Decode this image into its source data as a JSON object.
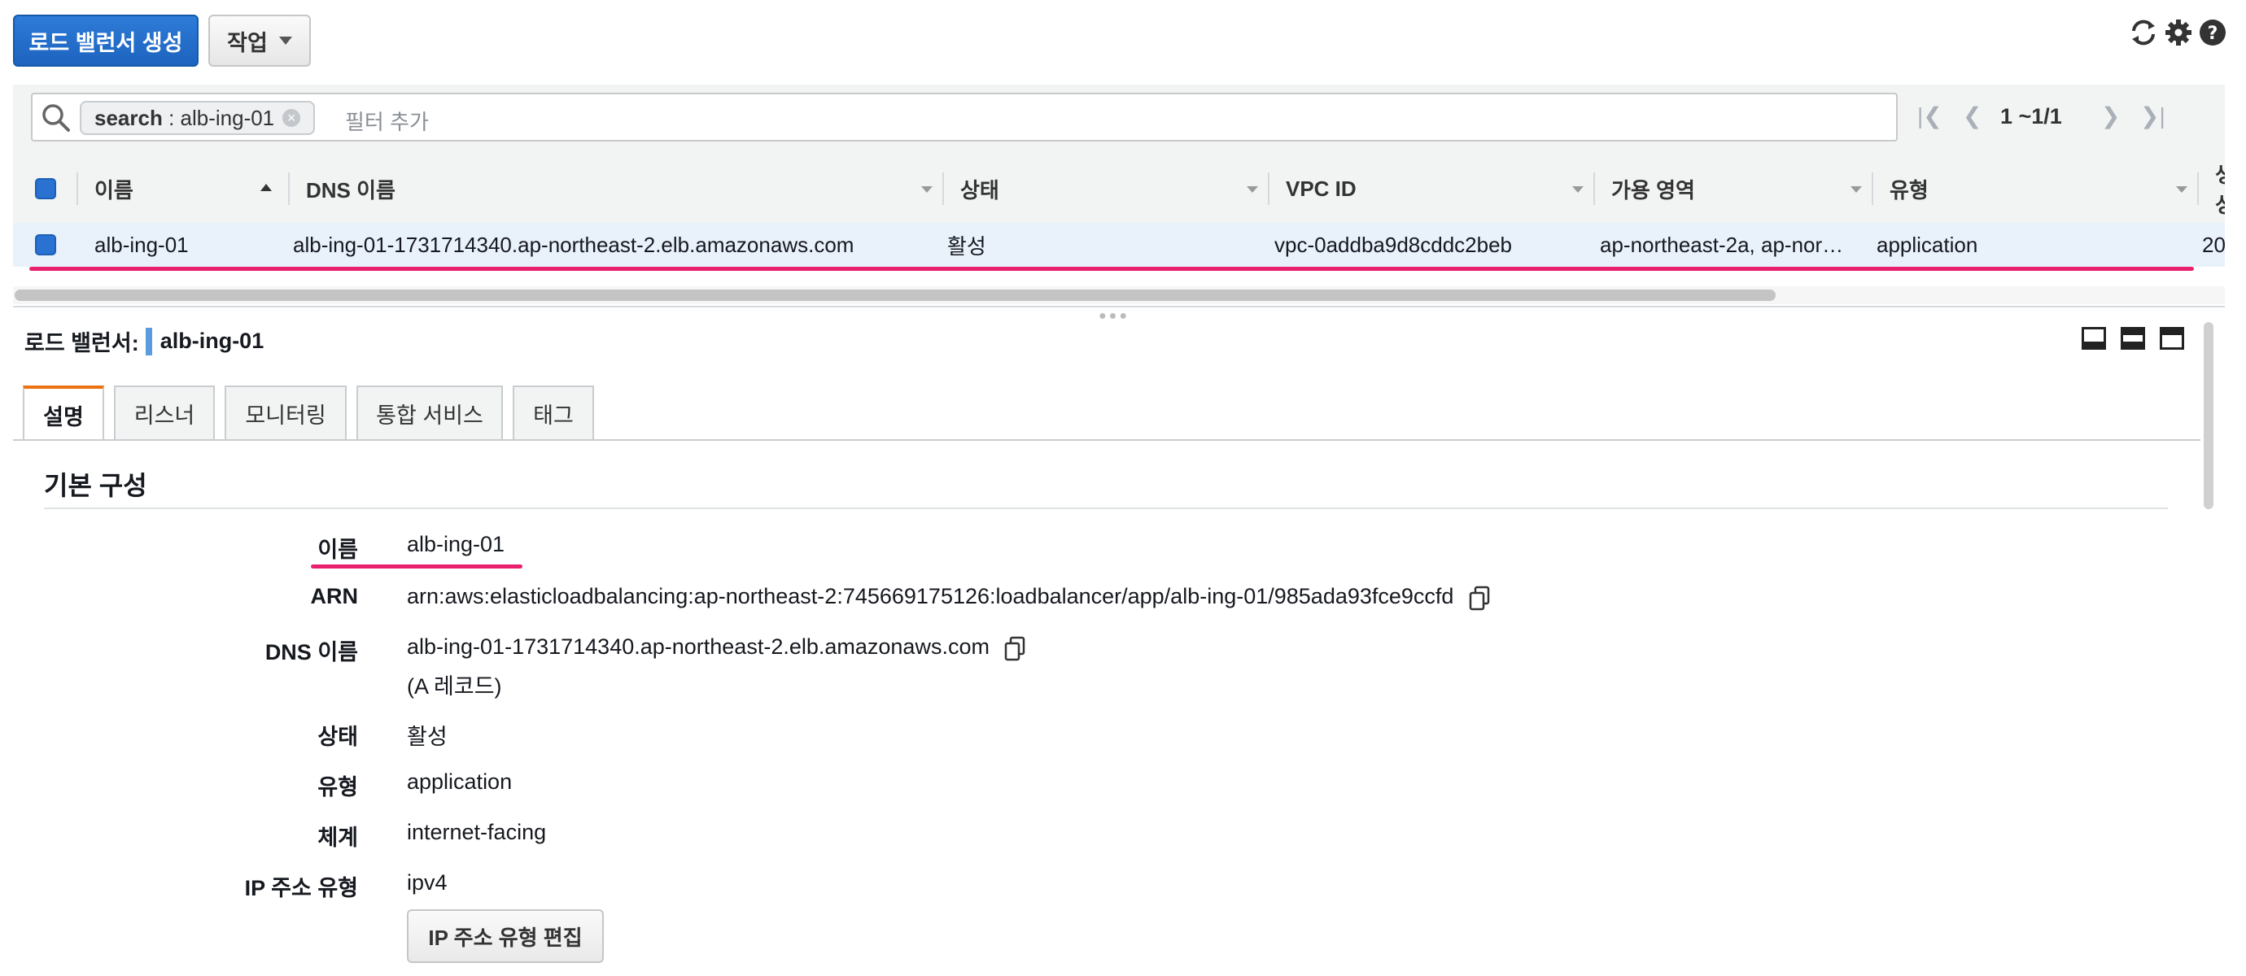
{
  "toolbar": {
    "create_label": "로드 밸런서 생성",
    "actions_label": "작업",
    "icons": [
      "refresh-icon",
      "gear-icon",
      "help-icon"
    ]
  },
  "filter": {
    "token_key": "search",
    "token_value": " : alb-ing-01",
    "placeholder": "필터 추가",
    "pagination": "1 ~1/1"
  },
  "table": {
    "columns": [
      "이름",
      "DNS 이름",
      "상태",
      "VPC ID",
      "가용 영역",
      "유형",
      "생성"
    ],
    "rows": [
      {
        "name": "alb-ing-01",
        "dns": "alb-ing-01-1731714340.ap-northeast-2.elb.amazonaws.com",
        "state": "활성",
        "vpc": "vpc-0addba9d8cddc2beb",
        "az": "ap-northeast-2a, ap-nor…",
        "type": "application",
        "created": "20"
      }
    ]
  },
  "details": {
    "title_prefix": "로드 밸런서:",
    "title_name": "alb-ing-01",
    "tabs": [
      "설명",
      "리스너",
      "모니터링",
      "통합 서비스",
      "태그"
    ],
    "active_tab": "설명",
    "section_heading": "기본 구성",
    "fields": {
      "name_label": "이름",
      "name_value": "alb-ing-01",
      "arn_label": "ARN",
      "arn_value": "arn:aws:elasticloadbalancing:ap-northeast-2:745669175126:loadbalancer/app/alb-ing-01/985ada93fce9ccfd",
      "dns_label": "DNS 이름",
      "dns_value": "alb-ing-01-1731714340.ap-northeast-2.elb.amazonaws.com",
      "dns_note": "(A 레코드)",
      "state_label": "상태",
      "state_value": "활성",
      "type_label": "유형",
      "type_value": "application",
      "scheme_label": "체계",
      "scheme_value": "internet-facing",
      "ip_type_label": "IP 주소 유형",
      "ip_type_value": "ipv4",
      "edit_ip_button": "IP 주소 유형 편집"
    }
  },
  "colors": {
    "primary": "#1c63be",
    "highlight": "#e8216f",
    "active_tab": "#ec7211",
    "selected_row": "#e9f1fb"
  }
}
